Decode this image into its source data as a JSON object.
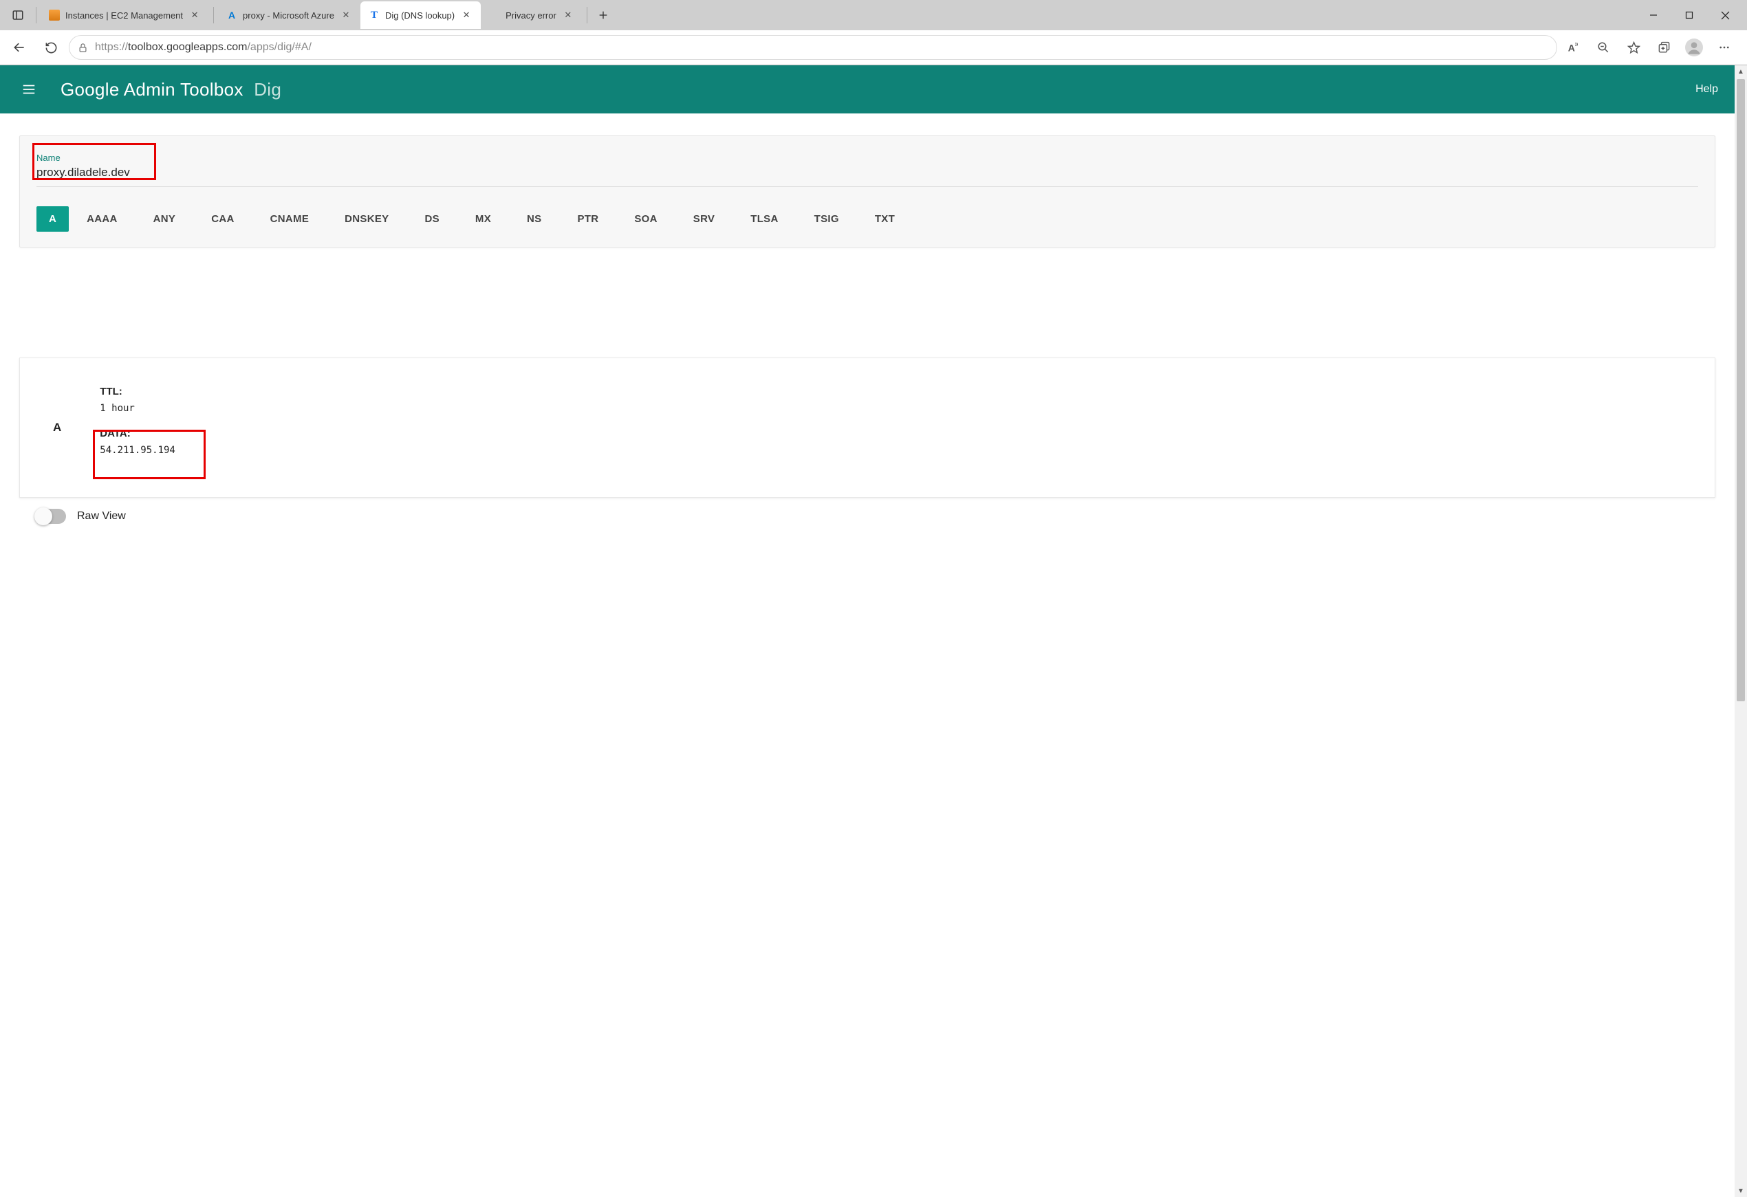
{
  "browser": {
    "tabs": [
      {
        "title": "Instances | EC2 Management",
        "icon": "aws"
      },
      {
        "title": "proxy - Microsoft Azure",
        "icon": "azure"
      },
      {
        "title": "Dig (DNS lookup)",
        "icon": "T",
        "active": true
      },
      {
        "title": "Privacy error",
        "icon": ""
      }
    ],
    "url_proto": "https://",
    "url_host": "toolbox.googleapps.com",
    "url_path": "/apps/dig/#A/"
  },
  "header": {
    "title_main": "Google Admin Toolbox",
    "title_sub": "Dig",
    "help": "Help"
  },
  "form": {
    "name_label": "Name",
    "name_value": "proxy.diladele.dev"
  },
  "record_types": [
    "A",
    "AAAA",
    "ANY",
    "CAA",
    "CNAME",
    "DNSKEY",
    "DS",
    "MX",
    "NS",
    "PTR",
    "SOA",
    "SRV",
    "TLSA",
    "TSIG",
    "TXT"
  ],
  "active_record_type": "A",
  "result": {
    "type": "A",
    "ttl_label": "TTL:",
    "ttl_value": "1 hour",
    "data_label": "DATA:",
    "data_value": "54.211.95.194"
  },
  "rawview_label": "Raw View"
}
